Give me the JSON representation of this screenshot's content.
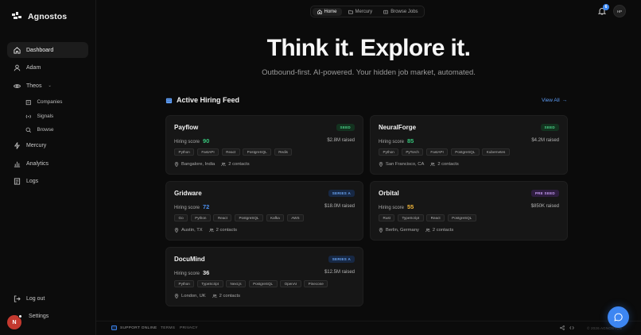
{
  "brand": {
    "name": "Agnostos"
  },
  "sidebar": {
    "items": [
      {
        "label": "Dashboard",
        "icon": "home-icon",
        "active": true
      },
      {
        "label": "Adam",
        "icon": "user-icon"
      },
      {
        "label": "Theos",
        "icon": "eye-icon"
      },
      {
        "label": "Mercury",
        "icon": "mercury-icon"
      },
      {
        "label": "Analytics",
        "icon": "bar-chart-icon"
      },
      {
        "label": "Logs",
        "icon": "logs-icon"
      }
    ],
    "theos_sub": [
      {
        "label": "Companies",
        "icon": "building-icon"
      },
      {
        "label": "Signals",
        "icon": "signal-icon"
      },
      {
        "label": "Browse",
        "icon": "search-icon"
      }
    ],
    "bottom": [
      {
        "label": "Log out",
        "icon": "logout-icon"
      },
      {
        "label": "Settings",
        "icon": "gear-icon"
      }
    ],
    "user_initial": "N"
  },
  "topnav": {
    "tabs": [
      {
        "label": "Home",
        "icon": "home-icon",
        "active": true
      },
      {
        "label": "Mercury",
        "icon": "folder-icon"
      },
      {
        "label": "Browse Jobs",
        "icon": "book-icon"
      }
    ]
  },
  "header": {
    "notification_count": "6",
    "avatar_initials": "HP"
  },
  "hero": {
    "title": "Think it. Explore it.",
    "subtitle": "Outbound-first. AI-powered. Your hidden job market, automated."
  },
  "feed": {
    "title": "Active Hiring Feed",
    "view_all": "View All",
    "score_label": "Hiring score",
    "companies": [
      {
        "name": "Payflow",
        "stage": "SEED",
        "stage_kind": "seed",
        "score": "90",
        "score_color": "#36c47a",
        "raised": "$2.8M raised",
        "tags": [
          "Python",
          "FastAPI",
          "React",
          "PostgreSQL",
          "Redis"
        ],
        "location": "Bangalore, India",
        "contacts": "2 contacts"
      },
      {
        "name": "NeuralForge",
        "stage": "SEED",
        "stage_kind": "seed",
        "score": "85",
        "score_color": "#36c47a",
        "raised": "$4.2M raised",
        "tags": [
          "Python",
          "PyTorch",
          "FastAPI",
          "PostgreSQL",
          "Kubernetes"
        ],
        "location": "San Francisco, CA",
        "contacts": "2 contacts"
      },
      {
        "name": "Gridware",
        "stage": "SERIES A",
        "stage_kind": "series",
        "score": "72",
        "score_color": "#4b8ff0",
        "raised": "$18.0M raised",
        "tags": [
          "Go",
          "Python",
          "React",
          "PostgreSQL",
          "Kafka",
          "AWS"
        ],
        "location": "Austin, TX",
        "contacts": "2 contacts"
      },
      {
        "name": "Orbital",
        "stage": "PRE SEED",
        "stage_kind": "pre",
        "score": "55",
        "score_color": "#f0b53a",
        "raised": "$850K raised",
        "tags": [
          "Rust",
          "TypeScript",
          "React",
          "PostgreSQL"
        ],
        "location": "Berlin, Germany",
        "contacts": "2 contacts"
      },
      {
        "name": "DocuMind",
        "stage": "SERIES A",
        "stage_kind": "series",
        "score": "36",
        "score_color": "#e9e9e9",
        "raised": "$12.5M raised",
        "tags": [
          "Python",
          "TypeScript",
          "Next.js",
          "PostgreSQL",
          "OpenAI",
          "Pinecone"
        ],
        "location": "London, UK",
        "contacts": "2 contacts"
      }
    ]
  },
  "footer": {
    "support": "SUPPORT ONLINE",
    "terms": "TERMS",
    "privacy": "PRIVACY",
    "copyright": "© 2026 AGNOSTOS"
  }
}
